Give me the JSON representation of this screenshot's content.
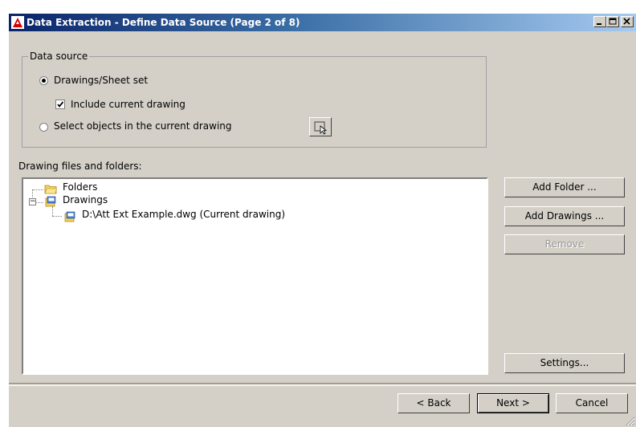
{
  "window": {
    "title": "Data Extraction - Define Data Source (Page 2 of 8)",
    "controls": [
      "minimize",
      "maximize",
      "close"
    ]
  },
  "data_source": {
    "group_label": "Data source",
    "option_drawings": {
      "label": "Drawings/Sheet set",
      "selected": true
    },
    "include_current": {
      "label": "Include current drawing",
      "checked": true
    },
    "option_select_objects": {
      "label": "Select objects in the current drawing",
      "selected": false
    },
    "pick_button_icon": "select-objects-icon"
  },
  "files_section": {
    "label": "Drawing files and folders:",
    "tree": [
      {
        "label": "Folders",
        "icon": "folder-icon",
        "level": 0
      },
      {
        "label": "Drawings",
        "icon": "drawing-set-icon",
        "level": 0,
        "expanded": true
      },
      {
        "label": "D:\\Att Ext Example.dwg (Current drawing)",
        "icon": "drawing-file-icon",
        "level": 1
      }
    ]
  },
  "side_buttons": {
    "add_folder": "Add Folder ...",
    "add_drawings": "Add Drawings ...",
    "remove": "Remove",
    "settings": "Settings..."
  },
  "footer": {
    "back": "< Back",
    "next": "Next >",
    "cancel": "Cancel"
  },
  "colors": {
    "dialog_bg": "#d4d0c8",
    "title_gradient_start": "#0a246a",
    "title_gradient_end": "#a6caf0"
  }
}
